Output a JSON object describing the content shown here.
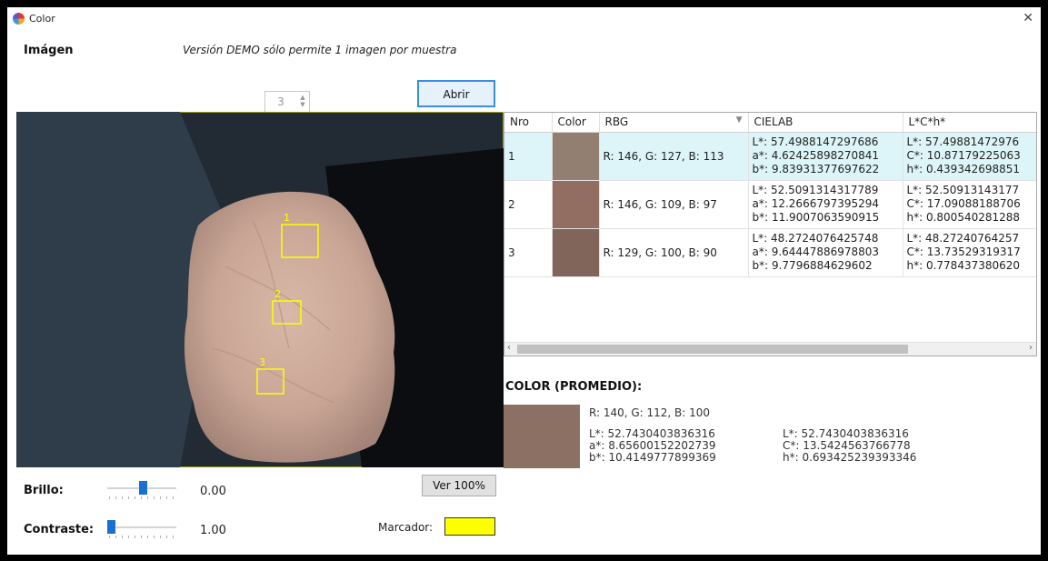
{
  "window": {
    "title": "Color",
    "close_glyph": "✕"
  },
  "header": {
    "imagen_label": "Imágen",
    "demo_note": "Versión DEMO sólo permite 1 imagen por muestra",
    "spinner_value": "3",
    "open_button": "Abrir"
  },
  "image": {
    "markers": [
      "1",
      "2",
      "3"
    ],
    "marker_color": "#ffff00"
  },
  "controls": {
    "brillo_label": "Brillo:",
    "brillo_value": "0.00",
    "contraste_label": "Contraste:",
    "contraste_value": "1.00",
    "ver_button": "Ver 100%",
    "marcador_label": "Marcador:",
    "marcador_color": "#ffff00"
  },
  "table": {
    "columns": [
      "Nro",
      "Color",
      "RBG",
      "CIELAB",
      "L*C*h*"
    ],
    "rows": [
      {
        "nro": "1",
        "color": "#927f71",
        "rgb": "R: 146, G: 127, B: 113",
        "lab": [
          "L*: 57.4988147297686",
          "a*: 4.62425898270841",
          "b*: 9.83931377697622"
        ],
        "lch": [
          "L*: 57.49881472976",
          "C*: 10.87179225063",
          "h*: 0.439342698851"
        ]
      },
      {
        "nro": "2",
        "color": "#926d61",
        "rgb": "R: 146, G: 109, B: 97",
        "lab": [
          "L*: 52.5091314317789",
          "a*: 12.2666797395294",
          "b*: 11.9007063590915"
        ],
        "lch": [
          "L*: 52.50913143177",
          "C*: 17.09088188706",
          "h*: 0.800540281288"
        ]
      },
      {
        "nro": "3",
        "color": "#81645a",
        "rgb": "R: 129, G: 100, B: 90",
        "lab": [
          "L*: 48.2724076425748",
          "a*: 9.64447886978803",
          "b*: 9.7796884629602"
        ],
        "lch": [
          "L*: 48.27240764257",
          "C*: 13.73529319317",
          "h*: 0.778437380620"
        ]
      }
    ]
  },
  "average": {
    "title": "COLOR (PROMEDIO):",
    "color": "#8c7064",
    "rgb": "R: 140, G: 112, B: 100",
    "lab": [
      "L*: 52.7430403836316",
      "a*: 8.65600152202739",
      "b*: 10.4149777899369"
    ],
    "lch": [
      "L*: 52.7430403836316",
      "C*: 13.5424563766778",
      "h*: 0.693425239393346"
    ]
  }
}
